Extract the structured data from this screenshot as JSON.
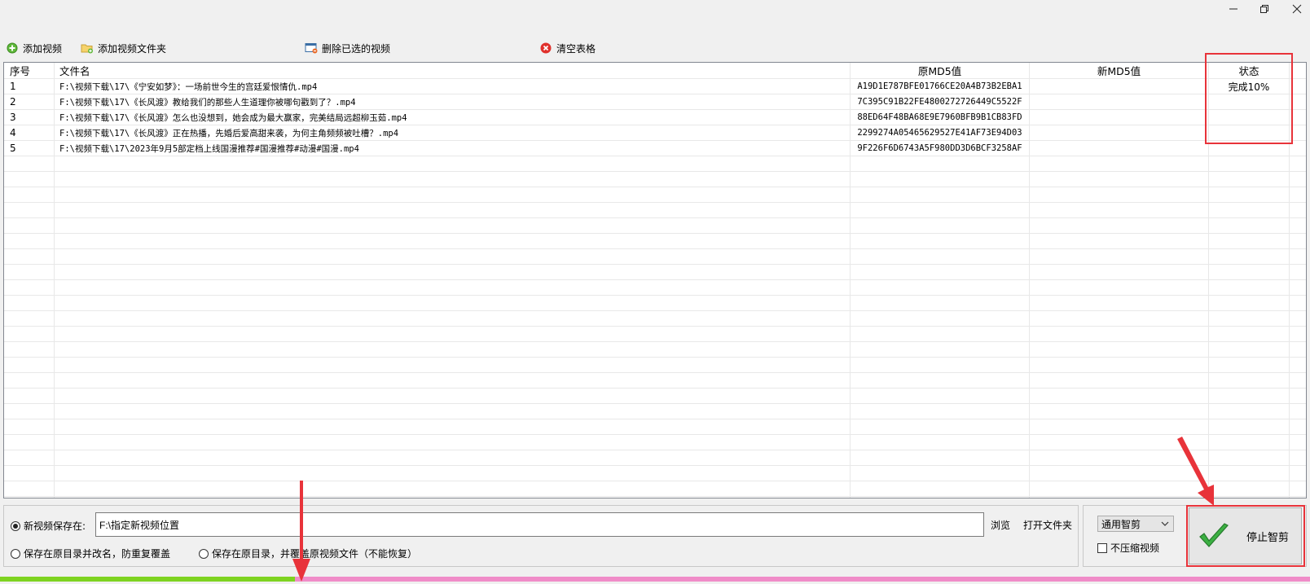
{
  "toolbar": {
    "add_video": "添加视频",
    "add_folder": "添加视频文件夹",
    "delete_selected": "删除已选的视频",
    "clear_table": "清空表格"
  },
  "table": {
    "columns": [
      "序号",
      "文件名",
      "原MD5值",
      "新MD5值",
      "状态"
    ],
    "rows": [
      {
        "index": "1",
        "file": "F:\\视频下载\\17\\《宁安如梦》：一场前世今生的宫廷爱恨情仇.mp4",
        "old_md5": "A19D1E787BFE01766CE20A4B73B2EBA1",
        "new_md5": "",
        "status": "完成10%"
      },
      {
        "index": "2",
        "file": "F:\\视频下载\\17\\《长风渡》教给我们的那些人生道理你被哪句戳到了？.mp4",
        "old_md5": "7C395C91B22FE4800272726449C5522F",
        "new_md5": "",
        "status": ""
      },
      {
        "index": "3",
        "file": "F:\\视频下载\\17\\《长风渡》怎么也没想到，她会成为最大赢家，完美结局远超柳玉茹.mp4",
        "old_md5": "88ED64F48BA68E9E7960BFB9B1CB83FD",
        "new_md5": "",
        "status": ""
      },
      {
        "index": "4",
        "file": "F:\\视频下载\\17\\《长风渡》正在热播，先婚后爱高甜来袭，为何主角频频被吐槽？.mp4",
        "old_md5": "2299274A05465629527E41AF73E94D03",
        "new_md5": "",
        "status": ""
      },
      {
        "index": "5",
        "file": "F:\\视频下载\\17\\2023年9月5部定档上线国漫推荐#国漫推荐#动漫#国漫.mp4",
        "old_md5": "9F226F6D6743A5F980DD3D6BCF3258AF",
        "new_md5": "",
        "status": ""
      }
    ]
  },
  "save": {
    "option_new_label": "新视频保存在:",
    "path_value": "F:\\指定新视频位置",
    "browse": "浏览",
    "open_folder": "打开文件夹",
    "option_rename": "保存在原目录并改名，防重复覆盖",
    "option_overwrite": "保存在原目录，并覆盖原视频文件（不能恢复）"
  },
  "mode": {
    "selected": "通用智剪",
    "no_compress": "不压缩视频"
  },
  "action": {
    "stop_label": "停止智剪"
  },
  "progress": {
    "fraction": 0.225
  },
  "colors": {
    "progress_done": "#7ed321",
    "progress_rest": "#f08cc8",
    "annotation": "#e8333a",
    "check_green": "#3cb043"
  }
}
